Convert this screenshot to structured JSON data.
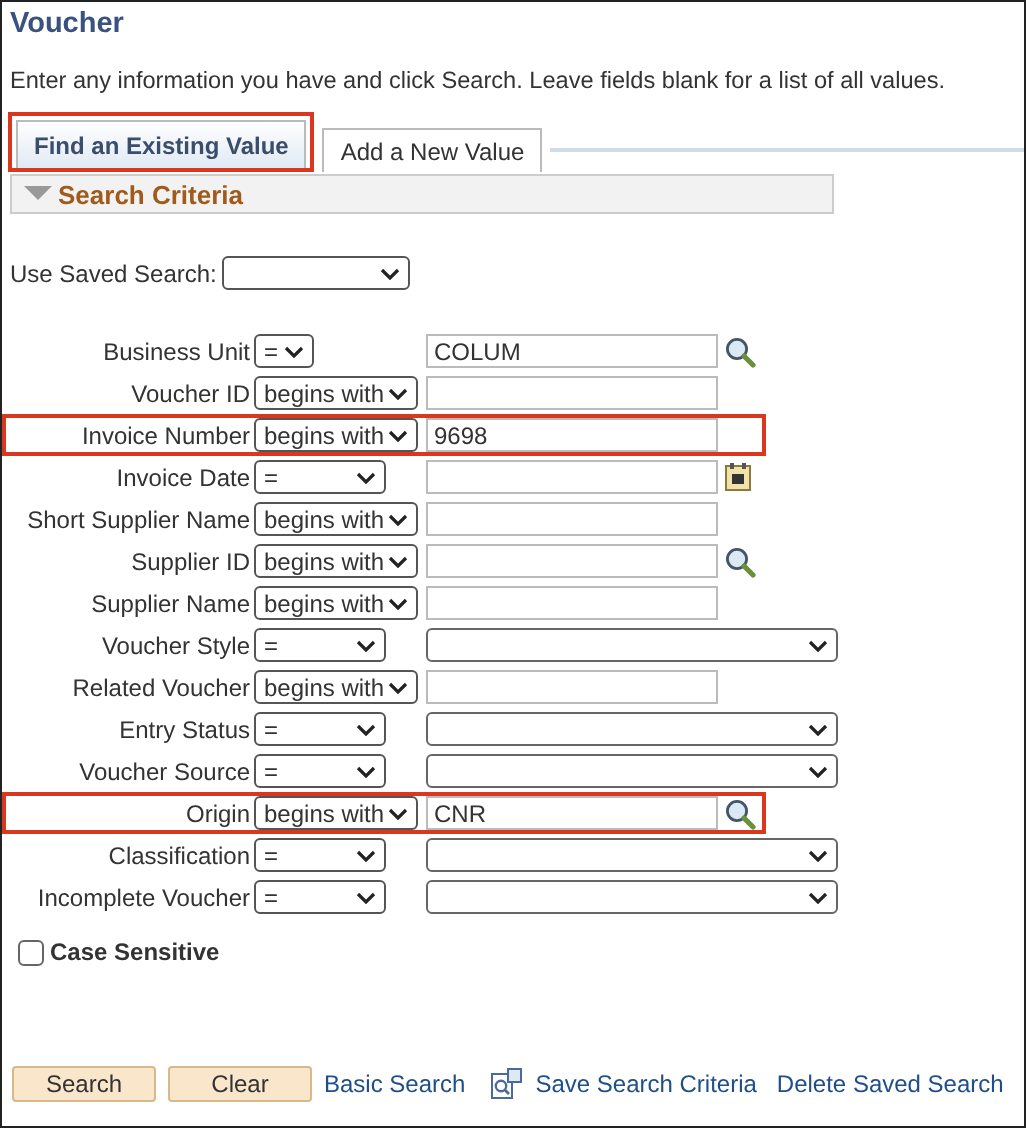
{
  "page": {
    "title": "Voucher",
    "instructions": "Enter any information you have and click Search. Leave fields blank for a list of all values."
  },
  "tabs": [
    {
      "label": "Find an Existing Value",
      "selected": true,
      "highlighted": true
    },
    {
      "label": "Add a New Value",
      "selected": false,
      "highlighted": false
    }
  ],
  "section": {
    "title": "Search Criteria",
    "expanded": true
  },
  "saved_search": {
    "label": "Use Saved Search:"
  },
  "criteria": [
    {
      "label": "Business Unit",
      "operator": {
        "label": "=",
        "kind": "narrow"
      },
      "kind": "lookup",
      "value": "COLUM",
      "highlighted": false
    },
    {
      "label": "Voucher ID",
      "operator": {
        "label": "begins with",
        "kind": "wide"
      },
      "kind": "text",
      "highlighted": false
    },
    {
      "label": "Invoice Number",
      "operator": {
        "label": "begins with",
        "kind": "wide"
      },
      "kind": "text",
      "value": "9698",
      "highlighted": true
    },
    {
      "label": "Invoice Date",
      "operator": {
        "label": "=",
        "kind": "medium"
      },
      "kind": "date",
      "highlighted": false
    },
    {
      "label": "Short Supplier Name",
      "operator": {
        "label": "begins with",
        "kind": "wide"
      },
      "kind": "text",
      "highlighted": false
    },
    {
      "label": "Supplier ID",
      "operator": {
        "label": "begins with",
        "kind": "wide"
      },
      "kind": "lookup",
      "highlighted": false
    },
    {
      "label": "Supplier Name",
      "operator": {
        "label": "begins with",
        "kind": "wide"
      },
      "kind": "text",
      "highlighted": false
    },
    {
      "label": "Voucher Style",
      "operator": {
        "label": "=",
        "kind": "medium"
      },
      "kind": "list",
      "highlighted": false
    },
    {
      "label": "Related Voucher",
      "operator": {
        "label": "begins with",
        "kind": "wide"
      },
      "kind": "text",
      "highlighted": false
    },
    {
      "label": "Entry Status",
      "operator": {
        "label": "=",
        "kind": "medium"
      },
      "kind": "list",
      "highlighted": false
    },
    {
      "label": "Voucher Source",
      "operator": {
        "label": "=",
        "kind": "medium"
      },
      "kind": "list",
      "highlighted": false
    },
    {
      "label": "Origin",
      "operator": {
        "label": "begins with",
        "kind": "wide"
      },
      "kind": "lookup",
      "value": "CNR",
      "highlighted": true
    },
    {
      "label": "Classification",
      "operator": {
        "label": "=",
        "kind": "medium"
      },
      "kind": "list",
      "highlighted": false
    },
    {
      "label": "Incomplete Voucher",
      "operator": {
        "label": "=",
        "kind": "medium"
      },
      "kind": "list",
      "highlighted": false
    }
  ],
  "case_sensitive": {
    "label": "Case Sensitive",
    "checked": false
  },
  "buttons": [
    "Search",
    "Clear"
  ],
  "links": [
    {
      "label": "Basic Search",
      "kind": "plain"
    },
    {
      "label": "Save Search Criteria",
      "kind": "icon"
    },
    {
      "label": "Delete Saved Search",
      "kind": "plain"
    }
  ]
}
